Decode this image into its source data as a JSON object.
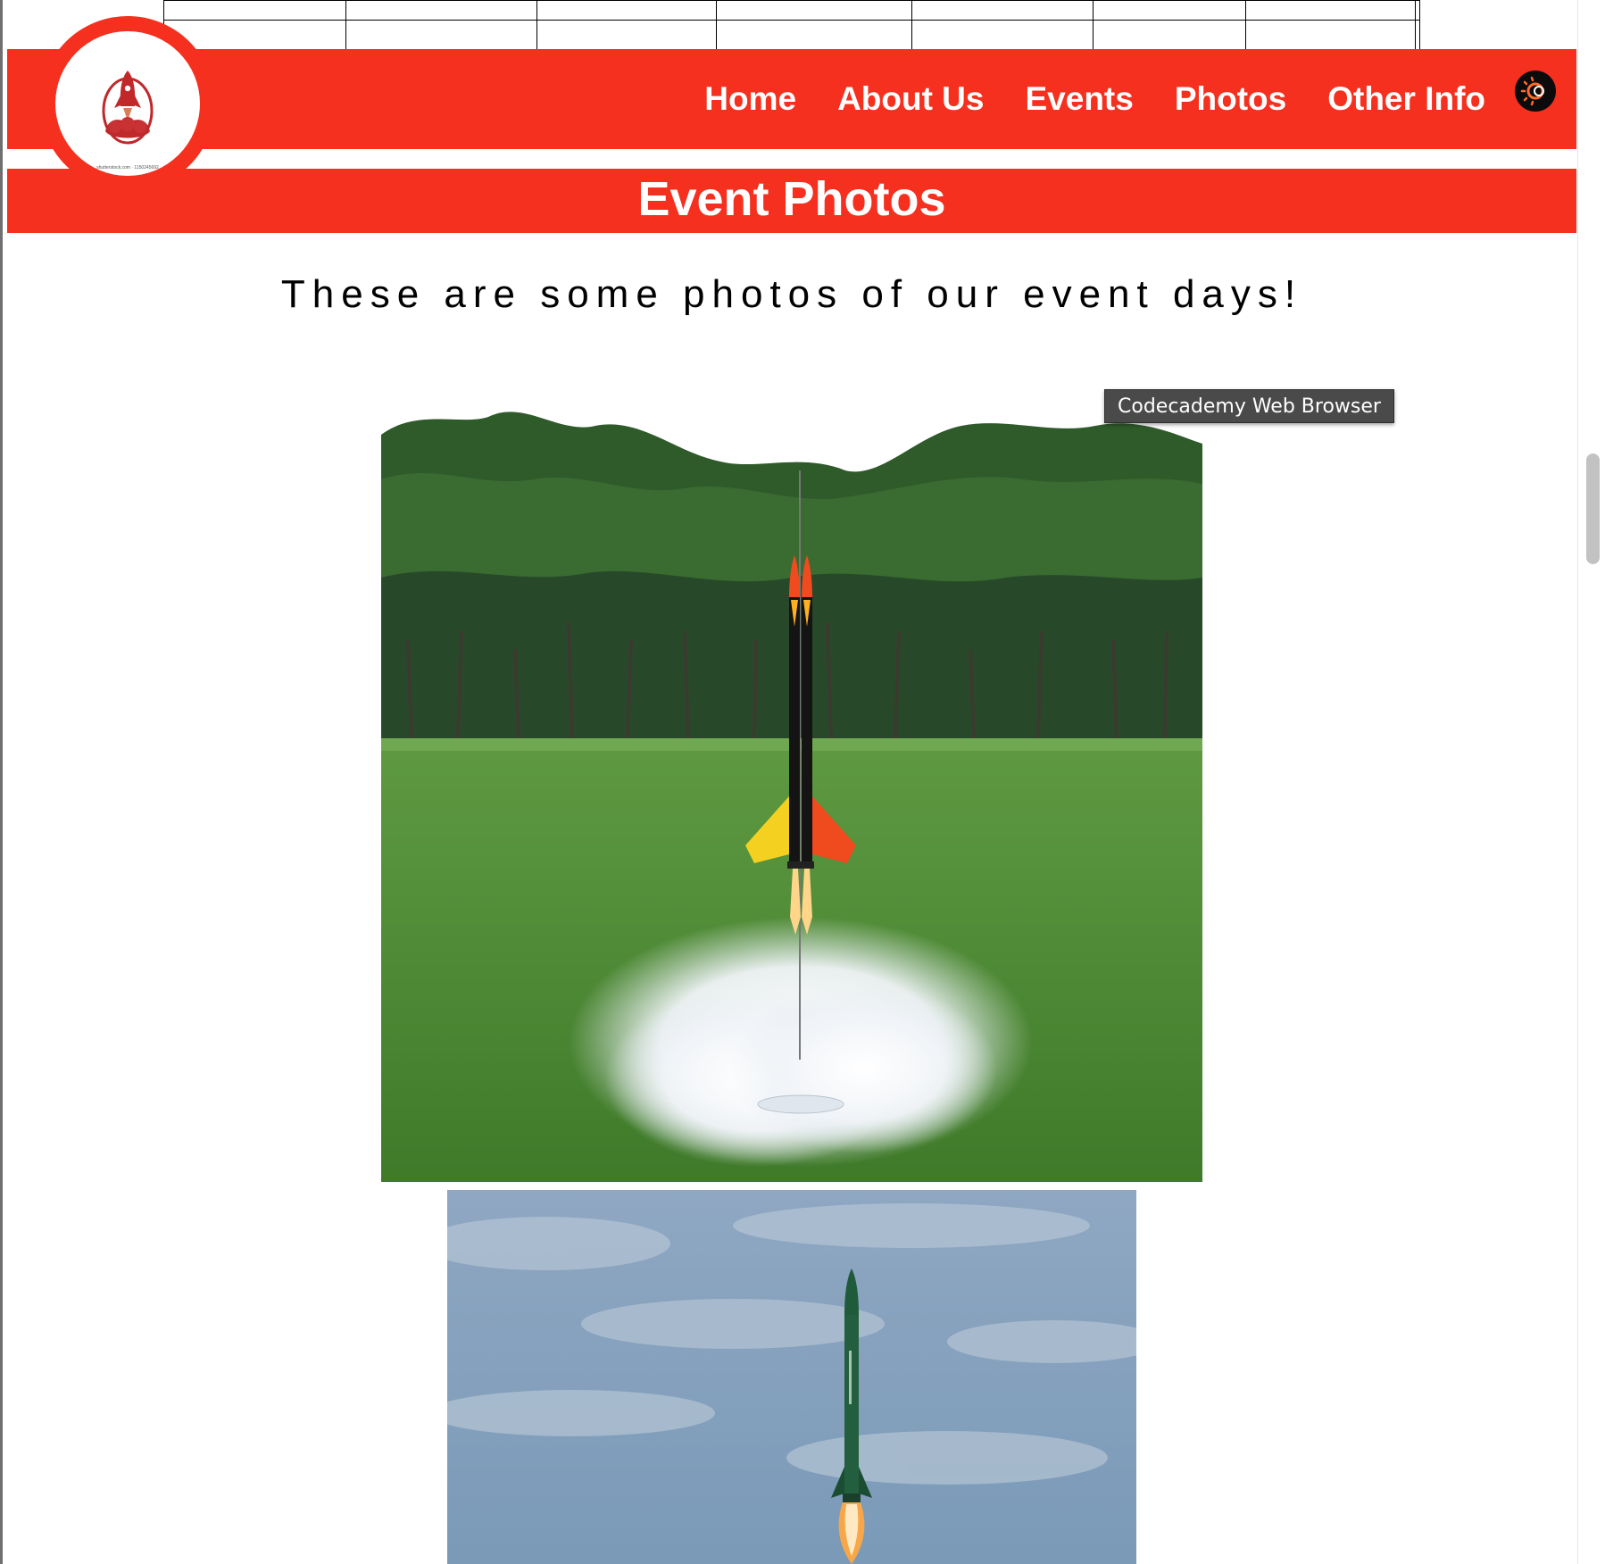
{
  "nav": {
    "items": [
      {
        "label": "Home"
      },
      {
        "label": "About Us"
      },
      {
        "label": "Events"
      },
      {
        "label": "Photos"
      },
      {
        "label": "Other Info"
      }
    ],
    "extension_icon": "browser-extension-icon"
  },
  "logo": {
    "icon": "rocket-launch-logo",
    "caption": "shutterstock.com · 1150245692"
  },
  "page": {
    "title": "Event Photos",
    "subtitle": "These are some photos of our event days!"
  },
  "tooltip": {
    "text": "Codecademy Web Browser"
  },
  "photos": [
    {
      "subject": "rocket-launch-on-grass-field-photo"
    },
    {
      "subject": "green-rocket-in-flight-photo"
    }
  ],
  "colors": {
    "brand_red": "#f5301f",
    "text_white": "#ffffff"
  }
}
